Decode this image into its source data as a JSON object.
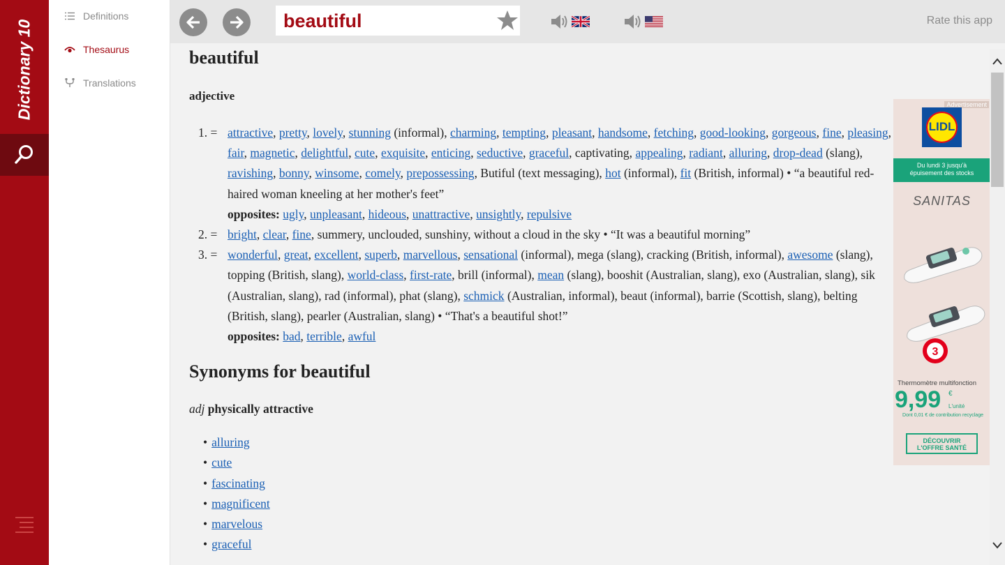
{
  "app": {
    "name": "Dictionary 10"
  },
  "nav": [
    {
      "label": "Definitions",
      "icon": "list-icon"
    },
    {
      "label": "Thesaurus",
      "icon": "eye-icon",
      "active": true
    },
    {
      "label": "Translations",
      "icon": "translate-icon"
    }
  ],
  "toolbar": {
    "search_value": "beautiful",
    "rate_label": "Rate this app",
    "uk_audio": "speaker-uk-flag",
    "us_audio": "speaker-us-flag"
  },
  "entry": {
    "word": "beautiful",
    "pos": "adjective",
    "senses": [
      {
        "num": "1. =",
        "parts": [
          {
            "t": "attractive",
            "l": true
          },
          {
            "t": ", "
          },
          {
            "t": "pretty",
            "l": true
          },
          {
            "t": ", "
          },
          {
            "t": "lovely",
            "l": true
          },
          {
            "t": ", "
          },
          {
            "t": "stunning",
            "l": true
          },
          {
            "t": " (informal), "
          },
          {
            "t": "charming",
            "l": true
          },
          {
            "t": ", "
          },
          {
            "t": "tempting",
            "l": true
          },
          {
            "t": ", "
          },
          {
            "t": "pleasant",
            "l": true
          },
          {
            "t": ", "
          },
          {
            "t": "handsome",
            "l": true
          },
          {
            "t": ", "
          },
          {
            "t": "fetching",
            "l": true
          },
          {
            "t": ", "
          },
          {
            "t": "good-looking",
            "l": true
          },
          {
            "t": ", "
          },
          {
            "t": "gorgeous",
            "l": true
          },
          {
            "t": ", "
          },
          {
            "t": "fine",
            "l": true
          },
          {
            "t": ", "
          },
          {
            "t": "pleasing",
            "l": true
          },
          {
            "t": ", "
          },
          {
            "t": "fair",
            "l": true
          },
          {
            "t": ", "
          },
          {
            "t": "magnetic",
            "l": true
          },
          {
            "t": ", "
          },
          {
            "t": "delightful",
            "l": true
          },
          {
            "t": ", "
          },
          {
            "t": "cute",
            "l": true
          },
          {
            "t": ", "
          },
          {
            "t": "exquisite",
            "l": true
          },
          {
            "t": ", "
          },
          {
            "t": "enticing",
            "l": true
          },
          {
            "t": ", "
          },
          {
            "t": "seductive",
            "l": true
          },
          {
            "t": ", "
          },
          {
            "t": "graceful",
            "l": true
          },
          {
            "t": ", captivating, "
          },
          {
            "t": "appealing",
            "l": true
          },
          {
            "t": ", "
          },
          {
            "t": "radiant",
            "l": true
          },
          {
            "t": ", "
          },
          {
            "t": "alluring",
            "l": true
          },
          {
            "t": ", "
          },
          {
            "t": "drop-dead",
            "l": true
          },
          {
            "t": " (slang), "
          },
          {
            "t": "ravishing",
            "l": true
          },
          {
            "t": ", "
          },
          {
            "t": "bonny",
            "l": true
          },
          {
            "t": ", "
          },
          {
            "t": "winsome",
            "l": true
          },
          {
            "t": ", "
          },
          {
            "t": "comely",
            "l": true
          },
          {
            "t": ", "
          },
          {
            "t": "prepossessing",
            "l": true
          },
          {
            "t": ", Butiful (text messaging), "
          },
          {
            "t": "hot",
            "l": true
          },
          {
            "t": " (informal), "
          },
          {
            "t": "fit",
            "l": true
          },
          {
            "t": " (British, informal) • “a beautiful red-haired woman kneeling at her mother's feet”"
          }
        ],
        "opposites_label": "opposites:",
        "opposites": [
          "ugly",
          "unpleasant",
          "hideous",
          "unattractive",
          "unsightly",
          "repulsive"
        ]
      },
      {
        "num": "2. =",
        "parts": [
          {
            "t": "bright",
            "l": true
          },
          {
            "t": ", "
          },
          {
            "t": "clear",
            "l": true
          },
          {
            "t": ", "
          },
          {
            "t": "fine",
            "l": true
          },
          {
            "t": ", summery, unclouded, sunshiny, without a cloud in the sky • “It was a beautiful morning”"
          }
        ]
      },
      {
        "num": "3. =",
        "parts": [
          {
            "t": "wonderful",
            "l": true
          },
          {
            "t": ", "
          },
          {
            "t": "great",
            "l": true
          },
          {
            "t": ", "
          },
          {
            "t": "excellent",
            "l": true
          },
          {
            "t": ", "
          },
          {
            "t": "superb",
            "l": true
          },
          {
            "t": ", "
          },
          {
            "t": "marvellous",
            "l": true
          },
          {
            "t": ", "
          },
          {
            "t": "sensational",
            "l": true
          },
          {
            "t": " (informal), mega (slang), cracking (British, informal), "
          },
          {
            "t": "awesome",
            "l": true
          },
          {
            "t": " (slang), topping (British, slang), "
          },
          {
            "t": "world-class",
            "l": true
          },
          {
            "t": ", "
          },
          {
            "t": "first-rate",
            "l": true
          },
          {
            "t": ", brill (informal), "
          },
          {
            "t": "mean",
            "l": true
          },
          {
            "t": " (slang), booshit (Australian, slang), exo (Australian, slang), sik (Australian, slang), rad (informal), phat (slang), "
          },
          {
            "t": "schmick",
            "l": true
          },
          {
            "t": " (Australian, informal), beaut (informal), barrie (Scottish, slang), belting (British, slang), pearler (Australian, slang) • “That's a beautiful shot!”"
          }
        ],
        "opposites_label": "opposites:",
        "opposites": [
          "bad",
          "terrible",
          "awful"
        ]
      }
    ],
    "synonyms_heading": "Synonyms for beautiful",
    "synonym_sense": {
      "pos": "adj",
      "gloss": "physically attractive"
    },
    "synonym_list": [
      "alluring",
      "cute",
      "fascinating",
      "magnificent",
      "marvelous",
      "graceful"
    ]
  },
  "ad": {
    "label": "Advertisement",
    "logo_text": "LIDL",
    "banner_line1": "Du lundi 3 jusqu'à",
    "banner_line2": "épuisement des stocks",
    "brand": "SANITAS",
    "product": "Thermomètre multifonction",
    "price": "9,99",
    "currency": "€",
    "unit": "L'unité",
    "recycling": "Dont 0,01 € de contribution recyclage",
    "cta_line1": "DÉCOUVRIR",
    "cta_line2": "L'OFFRE SANTÉ",
    "colors": {
      "green": "#1aa37a",
      "lidl_blue": "#0d4ea0",
      "lidl_yellow": "#ffe600"
    }
  },
  "theme": {
    "accent": "#a30b14",
    "link": "#1a5fb4"
  }
}
